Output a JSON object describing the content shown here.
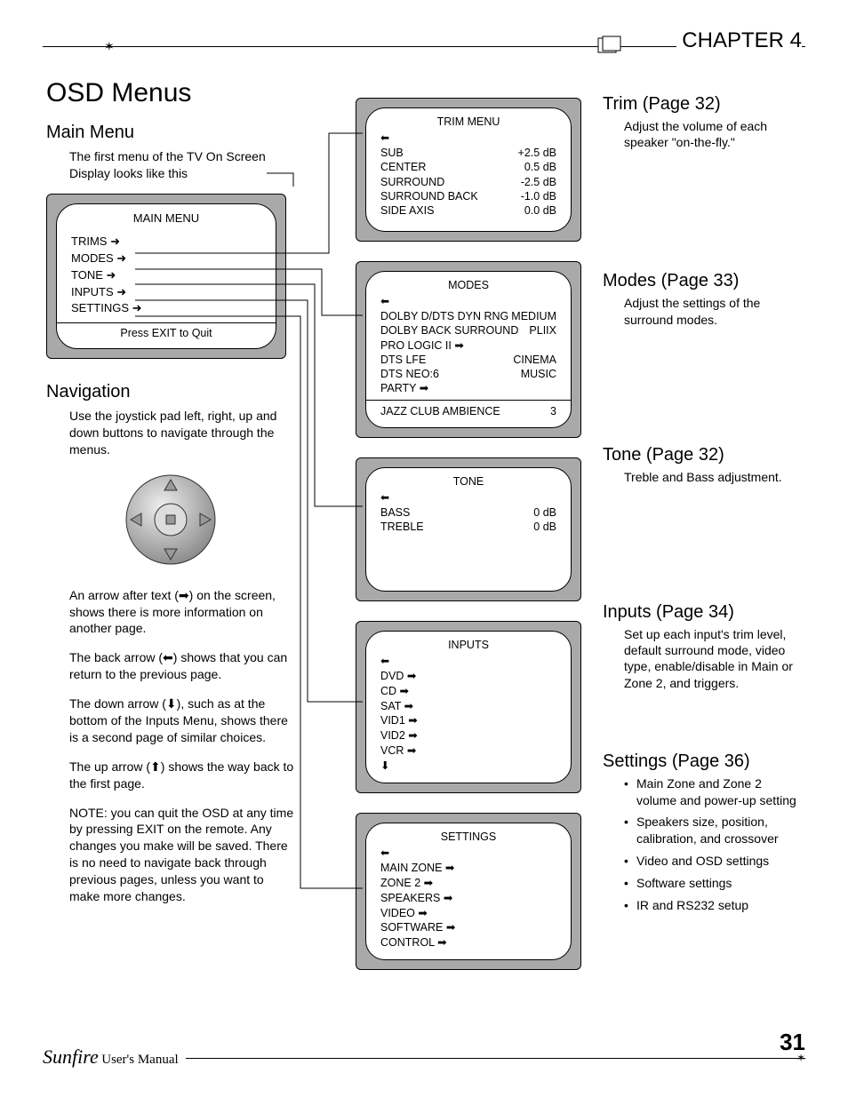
{
  "chapter": "CHAPTER 4",
  "title": "OSD Menus",
  "page_number": "31",
  "footer_brand": "Sunfire",
  "footer_label": "User's Manual",
  "main_menu": {
    "heading": "Main Menu",
    "desc": "The first menu of the TV On Screen Display looks like this",
    "screen_title": "MAIN MENU",
    "items": [
      "TRIMS",
      "MODES",
      "TONE",
      "INPUTS",
      "SETTINGS"
    ],
    "footer": "Press EXIT to Quit"
  },
  "navigation": {
    "heading": "Navigation",
    "desc": "Use the joystick pad left, right, up and down buttons to navigate through the menus.",
    "p_arrow_right": "An arrow after text (➡) on the screen, shows there is more information on another page.",
    "p_arrow_left": "The back arrow (⬅) shows that you can return to the previous page.",
    "p_arrow_down": "The down arrow (⬇), such as at the bottom of the Inputs Menu, shows there is a second page of similar choices.",
    "p_arrow_up": "The up arrow (⬆) shows the way back to the first page.",
    "p_note": "NOTE: you can quit the OSD at any time by pressing EXIT on the remote. Any changes you make will be saved. There is no need to navigate back through previous pages, unless you want to make more changes."
  },
  "screens": {
    "trim": {
      "title": "TRIM  MENU",
      "rows": [
        {
          "l": "SUB",
          "r": "+2.5  dB"
        },
        {
          "l": "CENTER",
          "r": "0.5  dB"
        },
        {
          "l": "SURROUND",
          "r": "-2.5  dB"
        },
        {
          "l": "SURROUND BACK",
          "r": "-1.0  dB"
        },
        {
          "l": "SIDE AXIS",
          "r": "0.0  dB"
        }
      ]
    },
    "modes": {
      "title": "MODES",
      "rows": [
        {
          "l": "DOLBY D/DTS DYN RNG",
          "r": "MEDIUM"
        },
        {
          "l": "DOLBY BACK SURROUND",
          "r": "PLIIX"
        },
        {
          "l": "PRO LOGIC II ➡",
          "r": ""
        },
        {
          "l": "DTS LFE",
          "r": "CINEMA"
        },
        {
          "l": "DTS NEO:6",
          "r": "MUSIC"
        },
        {
          "l": "PARTY ➡",
          "r": ""
        },
        {
          "l": "JAZZ CLUB AMBIENCE",
          "r": "3"
        }
      ]
    },
    "tone": {
      "title": "TONE",
      "rows": [
        {
          "l": "BASS",
          "r": "0  dB"
        },
        {
          "l": "TREBLE",
          "r": "0  dB"
        }
      ]
    },
    "inputs": {
      "title": "INPUTS",
      "items": [
        "DVD ➡",
        "CD ➡",
        "SAT ➡",
        "VID1 ➡",
        "VID2 ➡",
        "VCR ➡"
      ]
    },
    "settings": {
      "title": "SETTINGS",
      "items": [
        "MAIN ZONE ➡",
        "ZONE 2 ➡",
        "SPEAKERS ➡",
        "VIDEO ➡",
        "SOFTWARE ➡",
        "CONTROL ➡"
      ]
    }
  },
  "right": {
    "trim_h": "Trim (Page 32)",
    "trim_b": "Adjust the volume of each speaker \"on-the-fly.\"",
    "modes_h": "Modes (Page 33)",
    "modes_b": "Adjust the settings of the surround modes.",
    "tone_h": "Tone (Page 32)",
    "tone_b": "Treble and Bass adjustment.",
    "inputs_h": "Inputs (Page 34)",
    "inputs_b": "Set up each input's trim level, default surround mode, video type, enable/disable in Main or Zone 2, and triggers.",
    "settings_h": "Settings (Page 36)",
    "settings_items": [
      "Main Zone and Zone 2 volume and power-up setting",
      "Speakers size, position, calibration, and crossover",
      "Video and OSD settings",
      "Software settings",
      "IR and RS232 setup"
    ]
  }
}
